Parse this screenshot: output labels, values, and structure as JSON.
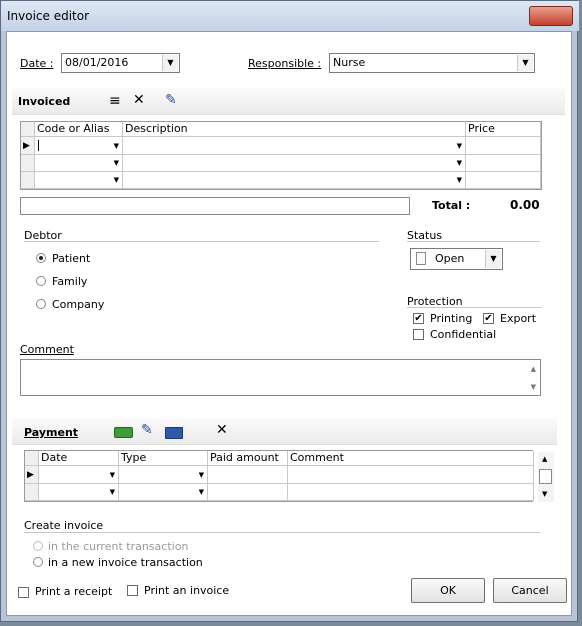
{
  "window": {
    "title": "Invoice editor",
    "close_glyph": "✕"
  },
  "header": {
    "date_label": "Date :",
    "date_value": "08/01/2016",
    "responsible_label": "Responsible :",
    "responsible_value": "Nurse"
  },
  "invoiced": {
    "title": "Invoiced",
    "columns": [
      "Code or Alias",
      "Description",
      "Price"
    ],
    "total_label": "Total :",
    "total_value": "0.00"
  },
  "debtor": {
    "title": "Debtor",
    "options": [
      "Patient",
      "Family",
      "Company"
    ],
    "selected": "Patient"
  },
  "status": {
    "title": "Status",
    "value": "Open"
  },
  "protection": {
    "title": "Protection",
    "printing_label": "Printing",
    "export_label": "Export",
    "confidential_label": "Confidential"
  },
  "comment": {
    "label": "Comment"
  },
  "payment": {
    "title": "Payment",
    "columns": [
      "Date",
      "Type",
      "Paid amount",
      "Comment"
    ]
  },
  "create_invoice": {
    "title": "Create invoice",
    "option_current": "in the current transaction",
    "option_new": "in a new invoice transaction"
  },
  "footer": {
    "print_receipt_label": "Print a receipt",
    "print_invoice_label": "Print an invoice",
    "ok_label": "OK",
    "cancel_label": "Cancel"
  },
  "icons": {
    "menu": "≡",
    "delete": "✕",
    "edit": "✎",
    "cash": "▬",
    "check": "✎",
    "card": "▭",
    "combo_arrow": "▼",
    "row_pointer": "▶",
    "scroll_up": "▲",
    "scroll_down": "▼",
    "checkmark": "✔"
  }
}
